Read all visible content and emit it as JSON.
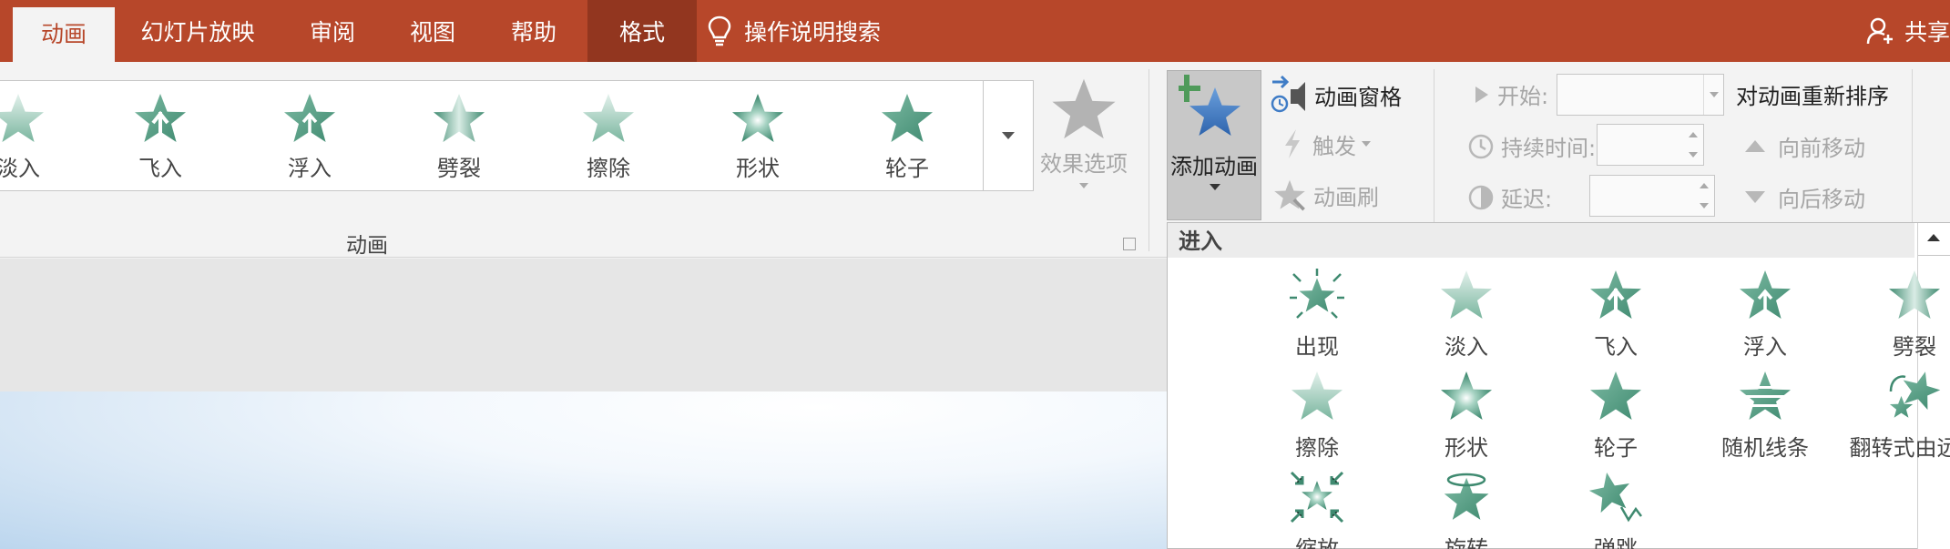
{
  "tabs": [
    {
      "label": "动画",
      "active": true
    },
    {
      "label": "幻灯片放映"
    },
    {
      "label": "审阅"
    },
    {
      "label": "视图"
    },
    {
      "label": "帮助"
    },
    {
      "label": "格式"
    }
  ],
  "tell_me": "操作说明搜索",
  "share": "共享",
  "gallery": {
    "items": [
      "淡入",
      "飞入",
      "浮入",
      "劈裂",
      "擦除",
      "形状",
      "轮子"
    ],
    "effect_options": "效果选项",
    "group_label": "动画"
  },
  "advanced": {
    "add_animation": "添加动画",
    "animation_pane": "动画窗格",
    "trigger": "触发",
    "animation_painter": "动画刷"
  },
  "timing": {
    "start_label": "开始:",
    "duration_label": "持续时间:",
    "delay_label": "延迟:",
    "reorder_title": "对动画重新排序",
    "move_earlier": "向前移动",
    "move_later": "向后移动"
  },
  "panel": {
    "header": "进入",
    "items": [
      "出现",
      "淡入",
      "飞入",
      "浮入",
      "劈裂",
      "擦除",
      "形状",
      "轮子",
      "随机线条",
      "翻转式由远...",
      "缩放",
      "旋转",
      "弹跳"
    ]
  },
  "colors": {
    "accent": "#b7472a",
    "format_tab": "#92361f",
    "star_green": "#5a9e86",
    "star_blue": "#3f7cc6",
    "plus_green": "#4f9a5a"
  }
}
